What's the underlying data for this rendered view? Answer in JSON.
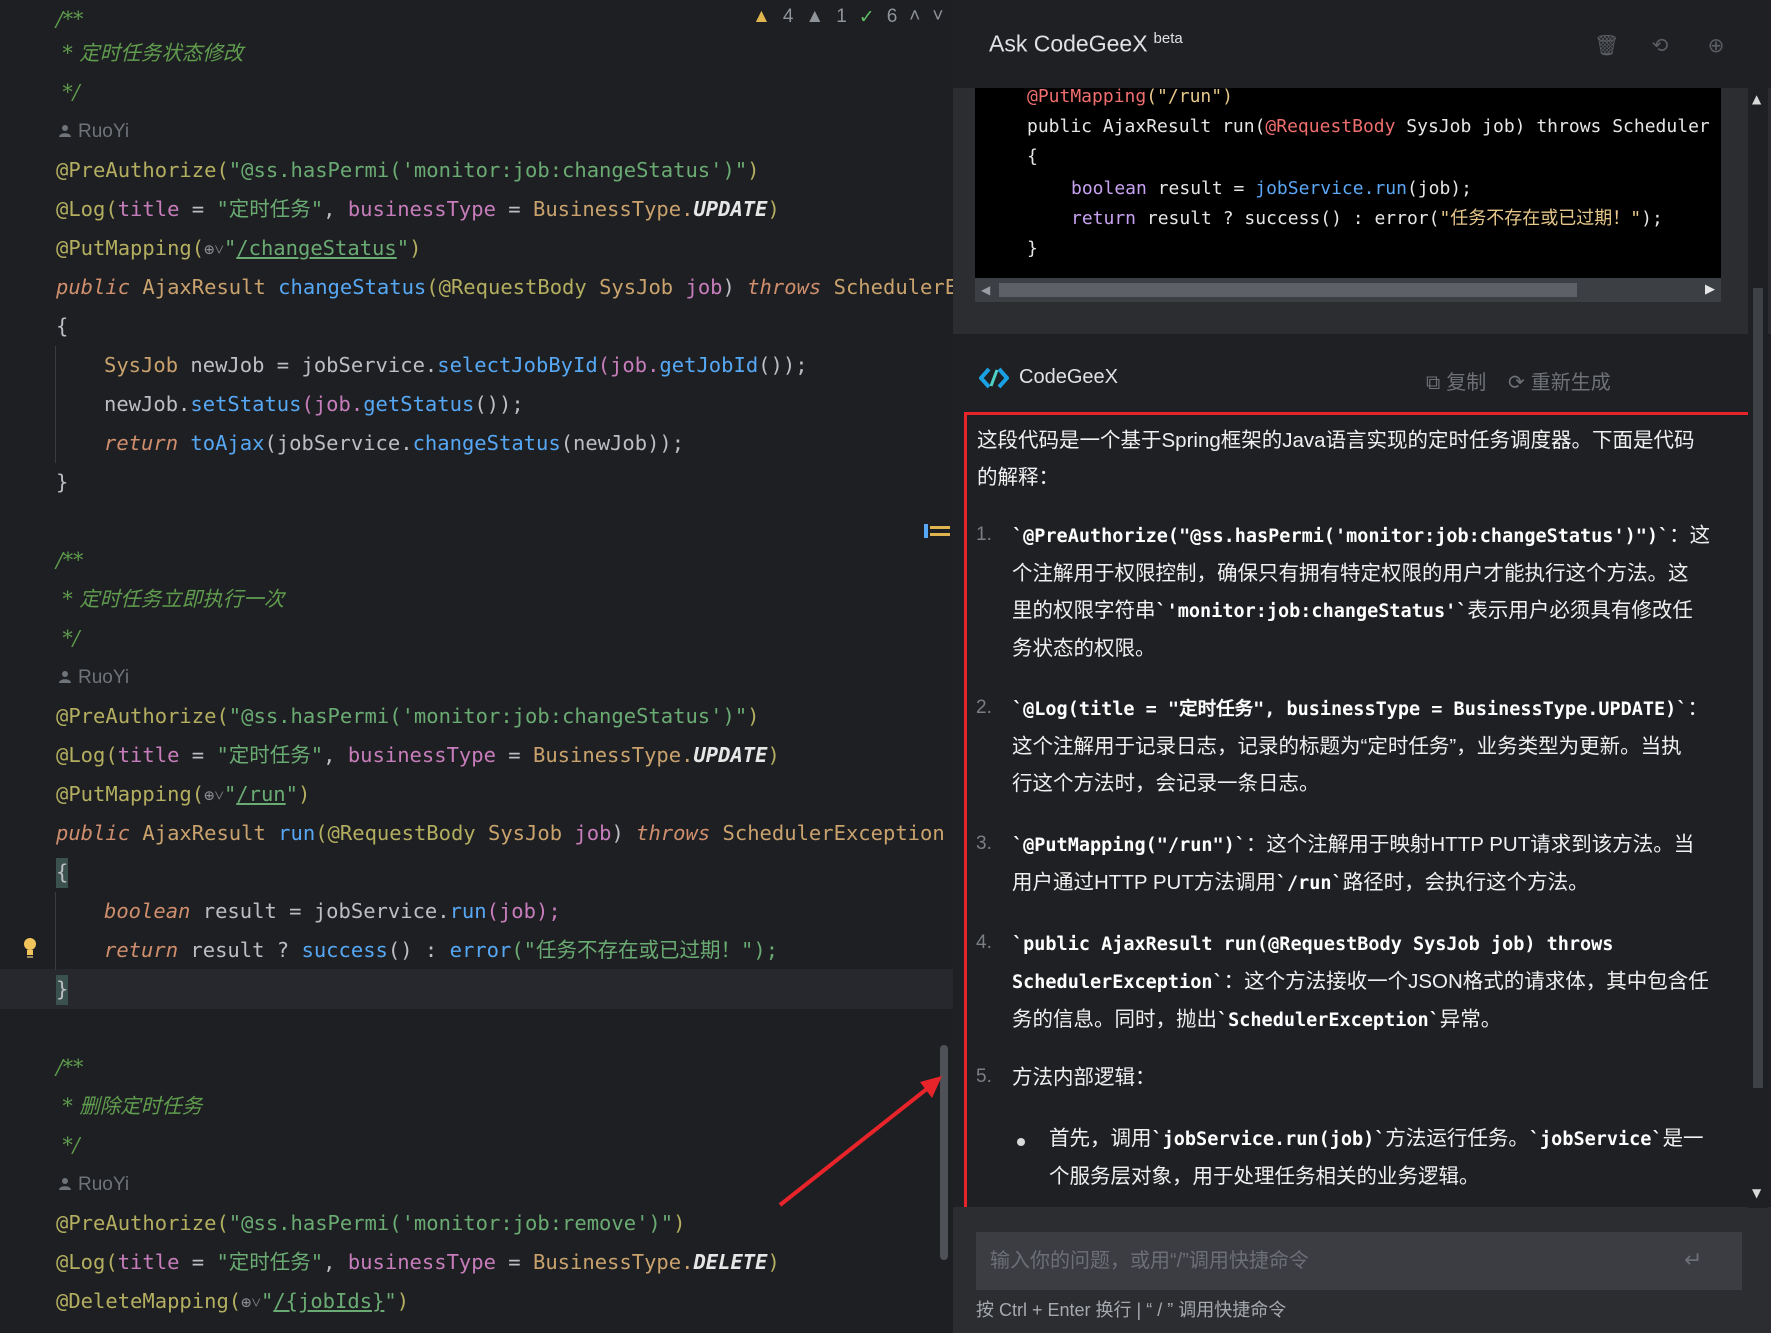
{
  "editor": {
    "inspections": {
      "warnings": "4",
      "weak_warnings": "1",
      "checks": "6"
    },
    "block1": {
      "doc_open": "/**",
      "doc_text": " * 定时任务状态修改",
      "doc_close": " */",
      "author": "RuoYi",
      "anno_preauth_prefix": "@PreAuthorize(",
      "anno_preauth_arg": "\"@ss.hasPermi('monitor:job:changeStatus')\"",
      "anno_close": ")",
      "log_prefix": "@Log(",
      "log_title_key": "title",
      "log_eq": " = ",
      "log_title_val": "\"定时任务\"",
      "log_comma": ", ",
      "log_bt_key": "businessType",
      "log_bt_cls": "BusinessType.",
      "log_bt_val": "UPDATE",
      "mapping_prefix": "@PutMapping(",
      "mapping_quote": "\"",
      "mapping_path": "/changeStatus",
      "sig_public": "public ",
      "sig_type": "AjaxResult ",
      "sig_name": "changeStatus",
      "sig_rest": "(@RequestBody ",
      "sig_ptype": "SysJob ",
      "sig_pname": "job",
      "sig_throws": "throws ",
      "sig_exc": "SchedulerExc",
      "brace_open": "{",
      "b1_type": "SysJob ",
      "b1_var": "newJob = jobService.",
      "b1_call": "selectJobById",
      "b1_arg": "(job.",
      "b1_get": "getJobId",
      "b1_end": "());",
      "b2_var": "newJob.",
      "b2_call": "setStatus",
      "b2_arg": "(job.",
      "b2_get": "getStatus",
      "b2_end": "());",
      "b3_ret": "return ",
      "b3_call": "toAjax",
      "b3_arg": "(jobService.",
      "b3_call2": "changeStatus",
      "b3_end": "(newJob));",
      "brace_close": "}"
    },
    "block2": {
      "doc_open": "/**",
      "doc_text": " * 定时任务立即执行一次",
      "doc_close": " */",
      "author": "RuoYi",
      "mapping_path": "/run",
      "sig_name": "run",
      "sig_exc": "SchedulerException",
      "b1_kw": "boolean ",
      "b1_var": "result = jobService.",
      "b1_call": "run",
      "b1_arg": "(job);",
      "b2_ret": "return ",
      "b2_var": "result ? ",
      "b2_s": "success",
      "b2_mid": "() : ",
      "b2_e": "error",
      "b2_str": "(\"任务不存在或已过期！\");"
    },
    "block3": {
      "doc_open": "/**",
      "doc_text": " * 删除定时任务",
      "doc_close": " */",
      "author": "RuoYi",
      "anno_preauth_arg": "\"@ss.hasPermi('monitor:job:remove')\"",
      "log_bt_val": "DELETE",
      "mapping_prefix": "@DeleteMapping(",
      "mapping_path": "/{jobIds}"
    }
  },
  "panel": {
    "title": "Ask CodeGeeX",
    "title_badge": "beta",
    "header_icons": [
      "trash-icon",
      "history-icon",
      "add-icon"
    ],
    "code_block": {
      "l1_anno": "@PutMapping",
      "l1_str": "(\"/run\")",
      "l2_a": "public AjaxResult run(",
      "l2_anno": "@RequestBody",
      "l2_b": " SysJob job) throws Scheduler",
      "l3": "{",
      "l4_kw": "boolean",
      "l4_a": " result = ",
      "l4_m": "jobService.run",
      "l4_b": "(job);",
      "l5_kw": "return",
      "l5_a": " result ? success() : error(",
      "l5_str": "\"任务不存在或已过期！\"",
      "l5_b": ");",
      "l6": "}"
    },
    "answer": {
      "author": "CodeGeeX",
      "copy_label": "复制",
      "regen_label": "重新生成",
      "intro_1": "这段代码是一个基于Spring框架的Java语言实现的定时任务调度器。下面是代码",
      "intro_2": "的解释：",
      "items": [
        {
          "num": "1.",
          "code": "`@PreAuthorize(\"@ss.hasPermi('monitor:job:changeStatus')\")`",
          "t1": "：这",
          "l2": "个注解用于权限控制，确保只有拥有特定权限的用户才能执行这个方法。这",
          "l3a": "里的权限字符串",
          "l3code": "`'monitor:job:changeStatus'`",
          "l3b": "表示用户必须具有修改任",
          "l4": "务状态的权限。"
        },
        {
          "num": "2.",
          "code": "`@Log(title = \"定时任务\", businessType = BusinessType.UPDATE)`",
          "t1": "：",
          "l2": "这个注解用于记录日志，记录的标题为“定时任务”，业务类型为更新。当执",
          "l3": "行这个方法时，会记录一条日志。"
        },
        {
          "num": "3.",
          "code": "`@PutMapping(\"/run\")`",
          "t1": "：这个注解用于映射HTTP PUT请求到该方法。当",
          "l2a": "用户通过HTTP PUT方法调用",
          "l2code": "`/run`",
          "l2b": "路径时，会执行这个方法。"
        },
        {
          "num": "4.",
          "code": "`public AjaxResult run(@RequestBody SysJob job) throws",
          "l2code": "SchedulerException`",
          "l2b": "：这个方法接收一个JSON格式的请求体，其中包含任",
          "l3a": "务的信息。同时，抛出",
          "l3code": "`SchedulerException`",
          "l3b": "异常。"
        },
        {
          "num": "5.",
          "t1": "方法内部逻辑："
        }
      ],
      "bullet_a": "首先，调用",
      "bullet_code1": "`jobService.run(job)`",
      "bullet_b": "方法运行任务。",
      "bullet_code2": "`jobService`",
      "bullet_c": "是一",
      "bullet_l2": "个服务层对象，用于处理任务相关的业务逻辑。"
    },
    "input": {
      "placeholder": "输入你的问题，或用“/”调用快捷命令"
    },
    "hint": "按 Ctrl + Enter 换行 | “ / ” 调用快捷命令"
  }
}
